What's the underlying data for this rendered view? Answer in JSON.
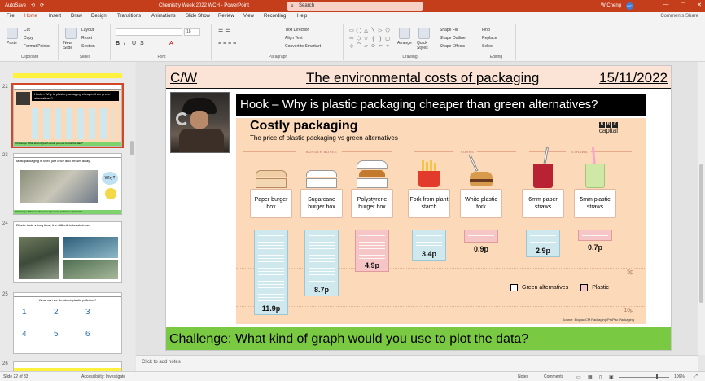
{
  "titlebar": {
    "quick": [
      "AutoSave",
      "⟲",
      "⟳"
    ],
    "doc_title": "Chemistry Week 2022 WCH - PowerPoint",
    "search_placeholder": "Search",
    "user": "W Cheng",
    "avatar": "WC",
    "win": [
      "—",
      "▢",
      "✕"
    ]
  },
  "menu": {
    "tabs": [
      "File",
      "Home",
      "Insert",
      "Draw",
      "Design",
      "Transitions",
      "Animations",
      "Slide Show",
      "Review",
      "View",
      "Recording",
      "Help"
    ],
    "active": "Home",
    "right": "Comments  Share"
  },
  "ribbon": {
    "clipboard": {
      "paste": "Paste",
      "cut": "Cut",
      "copy": "Copy",
      "format_painter": "Format Painter",
      "label": "Clipboard"
    },
    "slides": {
      "new_slide": "New Slide",
      "layout": "Layout",
      "reset": "Reset",
      "section": "Section",
      "label": "Slides"
    },
    "font": {
      "label": "Font",
      "size": "18"
    },
    "paragraph": {
      "text_direction": "Text Direction",
      "align_text": "Align Text",
      "convert": "Convert to SmartArt",
      "label": "Paragraph"
    },
    "drawing": {
      "arrange": "Arrange",
      "quick_styles": "Quick Styles",
      "fill": "Shape Fill",
      "outline": "Shape Outline",
      "effects": "Shape Effects",
      "label": "Drawing"
    },
    "editing": {
      "find": "Find",
      "replace": "Replace",
      "select": "Select",
      "label": "Editing"
    }
  },
  "thumbnails": [
    {
      "num": "22",
      "title": "Hook – Why is plastic packaging cheaper than green alternatives?",
      "footer": "Challenge: What kind of graph would you use to plot the data?"
    },
    {
      "num": "23",
      "title": "Most packaging is used just once and thrown away.",
      "footer": "Challenge: What are the uses, types and problems of plastic?"
    },
    {
      "num": "24",
      "title": "Plastic lasts a long time; it is difficult to break down.",
      "footer": ""
    },
    {
      "num": "25",
      "title": "What can we do about plastic pollution?",
      "footer": ""
    },
    {
      "num": "26",
      "title": "",
      "footer": ""
    }
  ],
  "slide": {
    "cw": "C/W",
    "title": "The environmental costs of packaging",
    "date": "15/11/2022",
    "hook": "Hook – Why is plastic packaging cheaper than green alternatives?",
    "challenge": "Challenge: What kind of graph would you use to plot the data?"
  },
  "infographic": {
    "title": "Costly packaging",
    "subtitle": "The price of plastic packaging vs green alternatives",
    "logo_top": "BBC",
    "logo_bottom": "capital",
    "sections": [
      "BURGER BOXES",
      "FORKS",
      "STRAWS"
    ],
    "legend": {
      "green": "Green alternatives",
      "plastic": "Plastic"
    },
    "gridlabels": [
      "5p",
      "10p"
    ],
    "source": "Source: Biopac/CM Packaging/ProPac Packaging",
    "items": [
      {
        "label": "Paper burger box",
        "value": "11.9p",
        "kind": "green"
      },
      {
        "label": "Sugarcane burger box",
        "value": "8.7p",
        "kind": "green"
      },
      {
        "label": "Polystyrene burger box",
        "value": "4.9p",
        "kind": "pink"
      },
      {
        "label": "Fork from plant starch",
        "value": "3.4p",
        "kind": "green"
      },
      {
        "label": "White plastic fork",
        "value": "0.9p",
        "kind": "pink"
      },
      {
        "label": "6mm paper straws",
        "value": "2.9p",
        "kind": "green"
      },
      {
        "label": "5mm plastic straws",
        "value": "0.7p",
        "kind": "pink"
      }
    ]
  },
  "notes": {
    "placeholder": "Click to add notes"
  },
  "status": {
    "slide": "Slide 22 of 33",
    "access": "Accessibility: Investigate",
    "notes": "Notes",
    "comments": "Comments",
    "zoom": "106%"
  },
  "colors": {
    "accent": "#c43e1c",
    "challenge": "#7ac943",
    "header": "#fbe4d5",
    "infobg": "#fcd9b8"
  }
}
